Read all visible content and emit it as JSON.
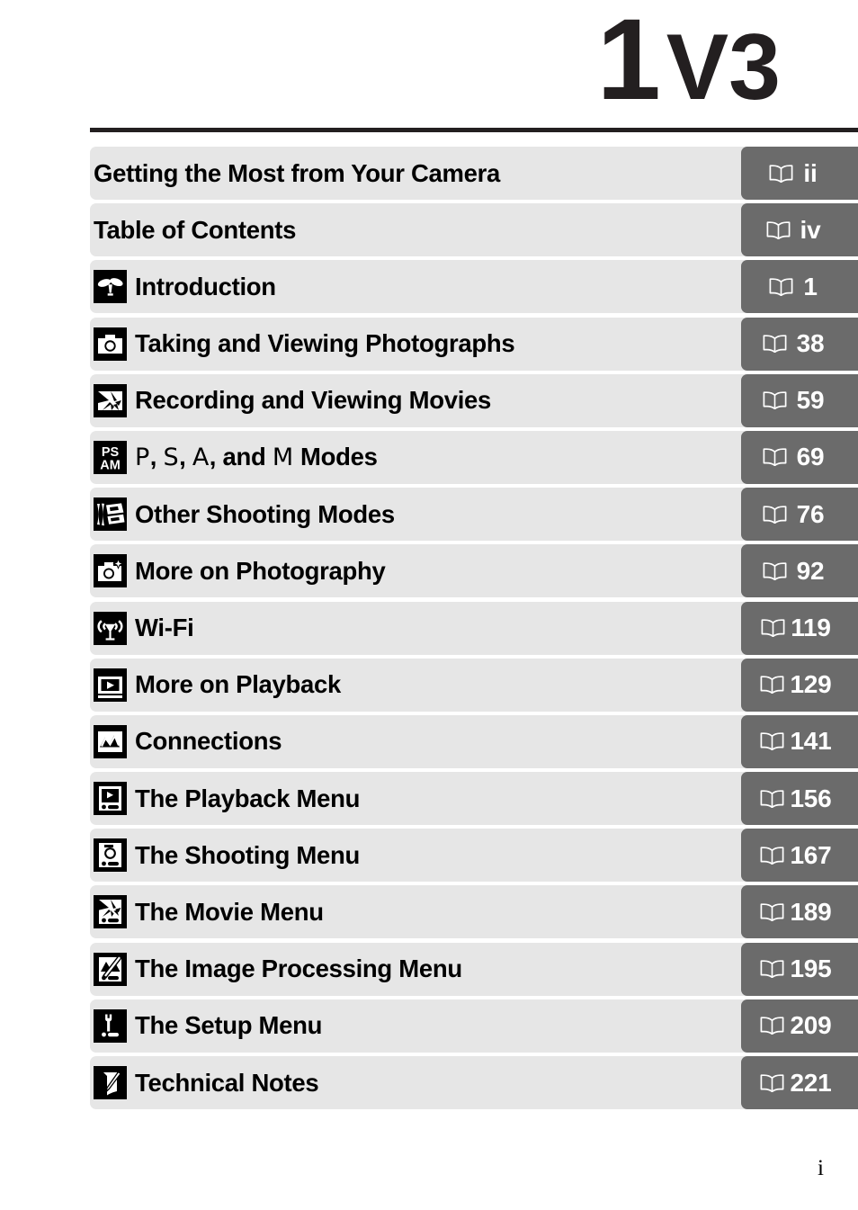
{
  "document": {
    "brand_number": "1",
    "brand_model": "V3",
    "folio": "i",
    "colors": {
      "row_background": "#e6e6e6",
      "page_chip_background": "#6b6b6b",
      "text": "#000000",
      "rule": "#231f20"
    }
  },
  "contents": {
    "rows": [
      {
        "label": "Getting the Most from Your Camera",
        "icon": "",
        "page": "ii"
      },
      {
        "label": "Table of Contents",
        "icon": "",
        "page": "iv"
      },
      {
        "label": "Introduction",
        "icon": "sprout-icon",
        "page": "1"
      },
      {
        "label": "Taking and Viewing Photographs",
        "icon": "camera-icon",
        "page": "38"
      },
      {
        "label": "Recording and Viewing Movies",
        "icon": "movie-icon",
        "page": "59"
      },
      {
        "label": "P, S, A, and M Modes",
        "icon": "psam-icon",
        "page": "69",
        "modes": true
      },
      {
        "label": "Other Shooting Modes",
        "icon": "film-strip-icon",
        "page": "76"
      },
      {
        "label": "More on Photography",
        "icon": "camera-star-icon",
        "page": "92"
      },
      {
        "label": "Wi-Fi",
        "icon": "wifi-icon",
        "page": "119"
      },
      {
        "label": "More on Playback",
        "icon": "playback-icon",
        "page": "129"
      },
      {
        "label": "Connections",
        "icon": "connections-icon",
        "page": "141"
      },
      {
        "label": "The Playback Menu",
        "icon": "playback-menu-icon",
        "page": "156"
      },
      {
        "label": "The Shooting Menu",
        "icon": "shooting-menu-icon",
        "page": "167"
      },
      {
        "label": "The Movie Menu",
        "icon": "movie-menu-icon",
        "page": "189"
      },
      {
        "label": "The Image Processing Menu",
        "icon": "image-processing-icon",
        "page": "195"
      },
      {
        "label": "The Setup Menu",
        "icon": "wrench-icon",
        "page": "209"
      },
      {
        "label": "Technical Notes",
        "icon": "pencil-note-icon",
        "page": "221"
      }
    ],
    "modes_row": {
      "p": "P",
      "comma1": ",",
      "s": "S",
      "comma2": ",",
      "a": "A",
      "comma3": ",",
      "and": "and",
      "m": "M",
      "modes": "Modes"
    },
    "page_icon_name": "book-icon"
  }
}
